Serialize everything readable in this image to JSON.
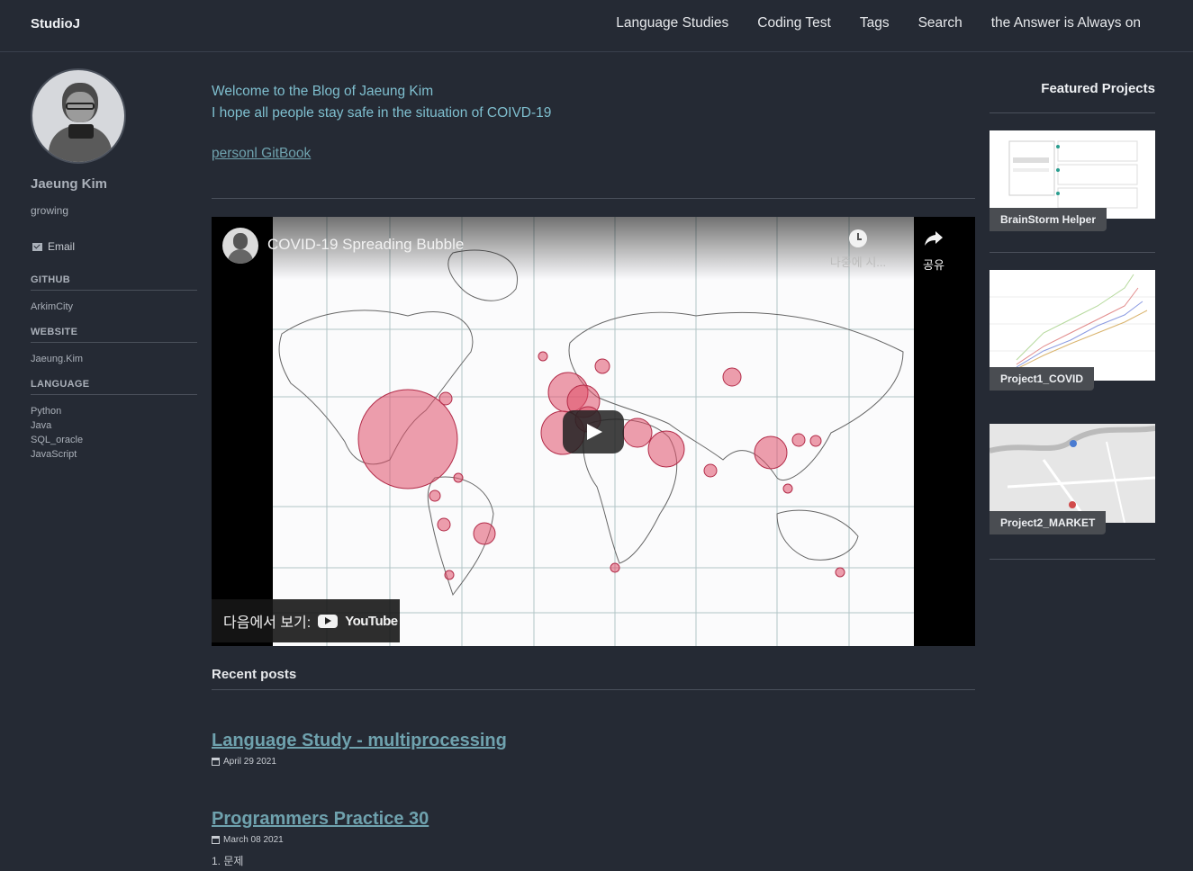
{
  "header": {
    "brand": "StudioJ",
    "nav": [
      "Language Studies",
      "Coding Test",
      "Tags",
      "Search",
      "the Answer is Always on"
    ]
  },
  "sidebar": {
    "name": "Jaeung Kim",
    "bio": "growing",
    "email_label": "Email",
    "sections": [
      {
        "title": "GITHUB",
        "items": [
          "ArkimCity"
        ]
      },
      {
        "title": "WEBSITE",
        "items": [
          "Jaeung.Kim"
        ]
      },
      {
        "title": "LANGUAGE",
        "items": [
          "Python",
          "Java",
          "SQL_oracle",
          "JavaScript"
        ]
      }
    ]
  },
  "main": {
    "welcome_line1": "Welcome to the Blog of Jaeung Kim",
    "welcome_line2": "I hope all people stay safe in the situation of COIVD-19",
    "gitbook_link": "personl GitBook",
    "video": {
      "title": "COVID-19 Spreading Bubble",
      "watch_later": "나중에 시...",
      "share": "공유",
      "watch_on": "다음에서 보기:",
      "youtube": "YouTube"
    },
    "recent_heading": "Recent posts",
    "posts": [
      {
        "title": "Language Study - multiprocessing",
        "date": "April 29 2021",
        "excerpt": ""
      },
      {
        "title": "Programmers Practice 30",
        "date": "March 08 2021",
        "excerpt": "1. 문제"
      }
    ]
  },
  "featured": {
    "title": "Featured Projects",
    "projects": [
      {
        "label": "BrainStorm Helper"
      },
      {
        "label": "Project1_COVID"
      },
      {
        "label": "Project2_MARKET"
      }
    ]
  },
  "colors": {
    "background": "#252a34",
    "link": "#6fa2ae",
    "welcome": "#7fbfcf",
    "bubble": "#e0506a"
  }
}
